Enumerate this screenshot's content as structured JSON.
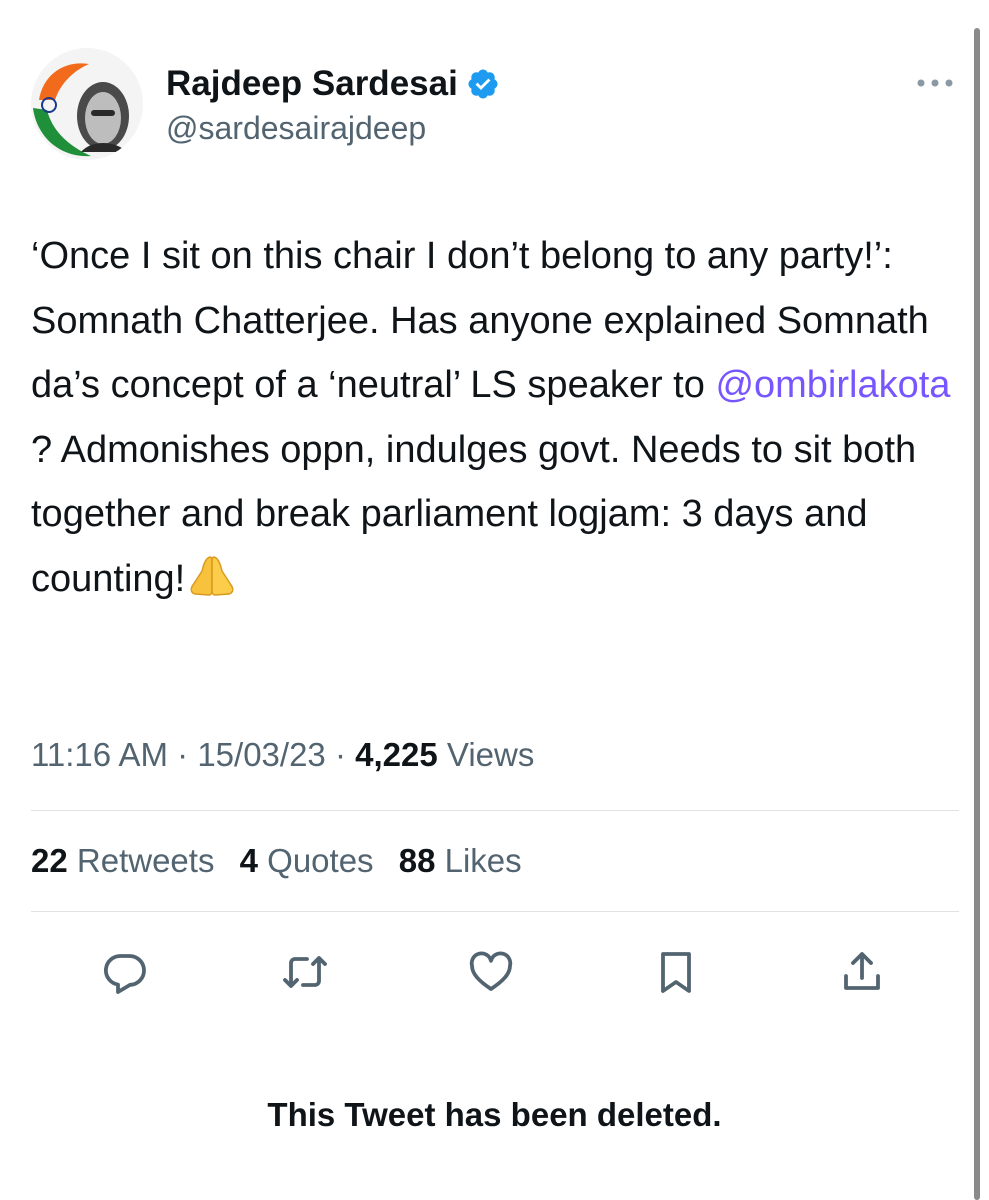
{
  "author": {
    "name": "Rajdeep Sardesai",
    "handle": "@sardesairajdeep",
    "verified_icon": "verified-badge-icon",
    "avatar_icon": "avatar-image"
  },
  "tweet": {
    "text_parts": {
      "part1": "‘Once I sit on this chair I don’t belong to any party!’: Somnath Chatterjee. Has anyone explained  Somnath da’s concept of a ‘neutral’ LS speaker to ",
      "mention": "@ombirlakota",
      "part2": "  ? Admonishes oppn, indulges govt. Needs to sit both together and break parliament logjam: 3 days and counting!"
    },
    "emoji": "folded-hands-emoji",
    "time": "11:16 AM",
    "date": "15/03/23",
    "separator": "·",
    "views_count": "4,225",
    "views_label": "Views"
  },
  "stats": {
    "retweets": {
      "count": "22",
      "label": "Retweets"
    },
    "quotes": {
      "count": "4",
      "label": "Quotes"
    },
    "likes": {
      "count": "88",
      "label": "Likes"
    }
  },
  "actions": [
    "reply-icon",
    "retweet-icon",
    "like-icon",
    "bookmark-icon",
    "share-icon"
  ],
  "notice": "This Tweet has been deleted.",
  "colors": {
    "text": "#0f1419",
    "secondary": "#536471",
    "mention": "#7856ff",
    "verified": "#1d9bf0",
    "divider": "#dfe3e6"
  }
}
